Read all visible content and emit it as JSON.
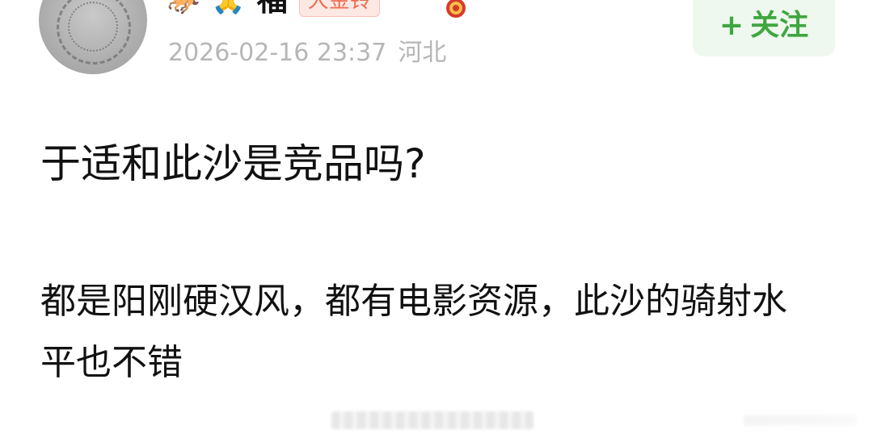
{
  "post": {
    "author": {
      "name": "福",
      "fan_badge": "大金铃",
      "emoji_1": "🐎",
      "emoji_2": "🙏"
    },
    "timestamp": "2026-02-16 23:37",
    "location": "河北",
    "follow_button": {
      "plus": "+",
      "label": "关注"
    },
    "title": "于适和此沙是竞品吗?",
    "body": "都是阳刚硬汉风，都有电影资源，此沙的骑射水平也不错"
  },
  "colors": {
    "accent_green": "#3fa63f",
    "follow_bg": "#eef8ee",
    "meta_gray": "#b6b6b6",
    "badge_red": "#ee6b4f"
  },
  "icons": {
    "avatar": "avatar-image",
    "medal": "medal-icon"
  }
}
